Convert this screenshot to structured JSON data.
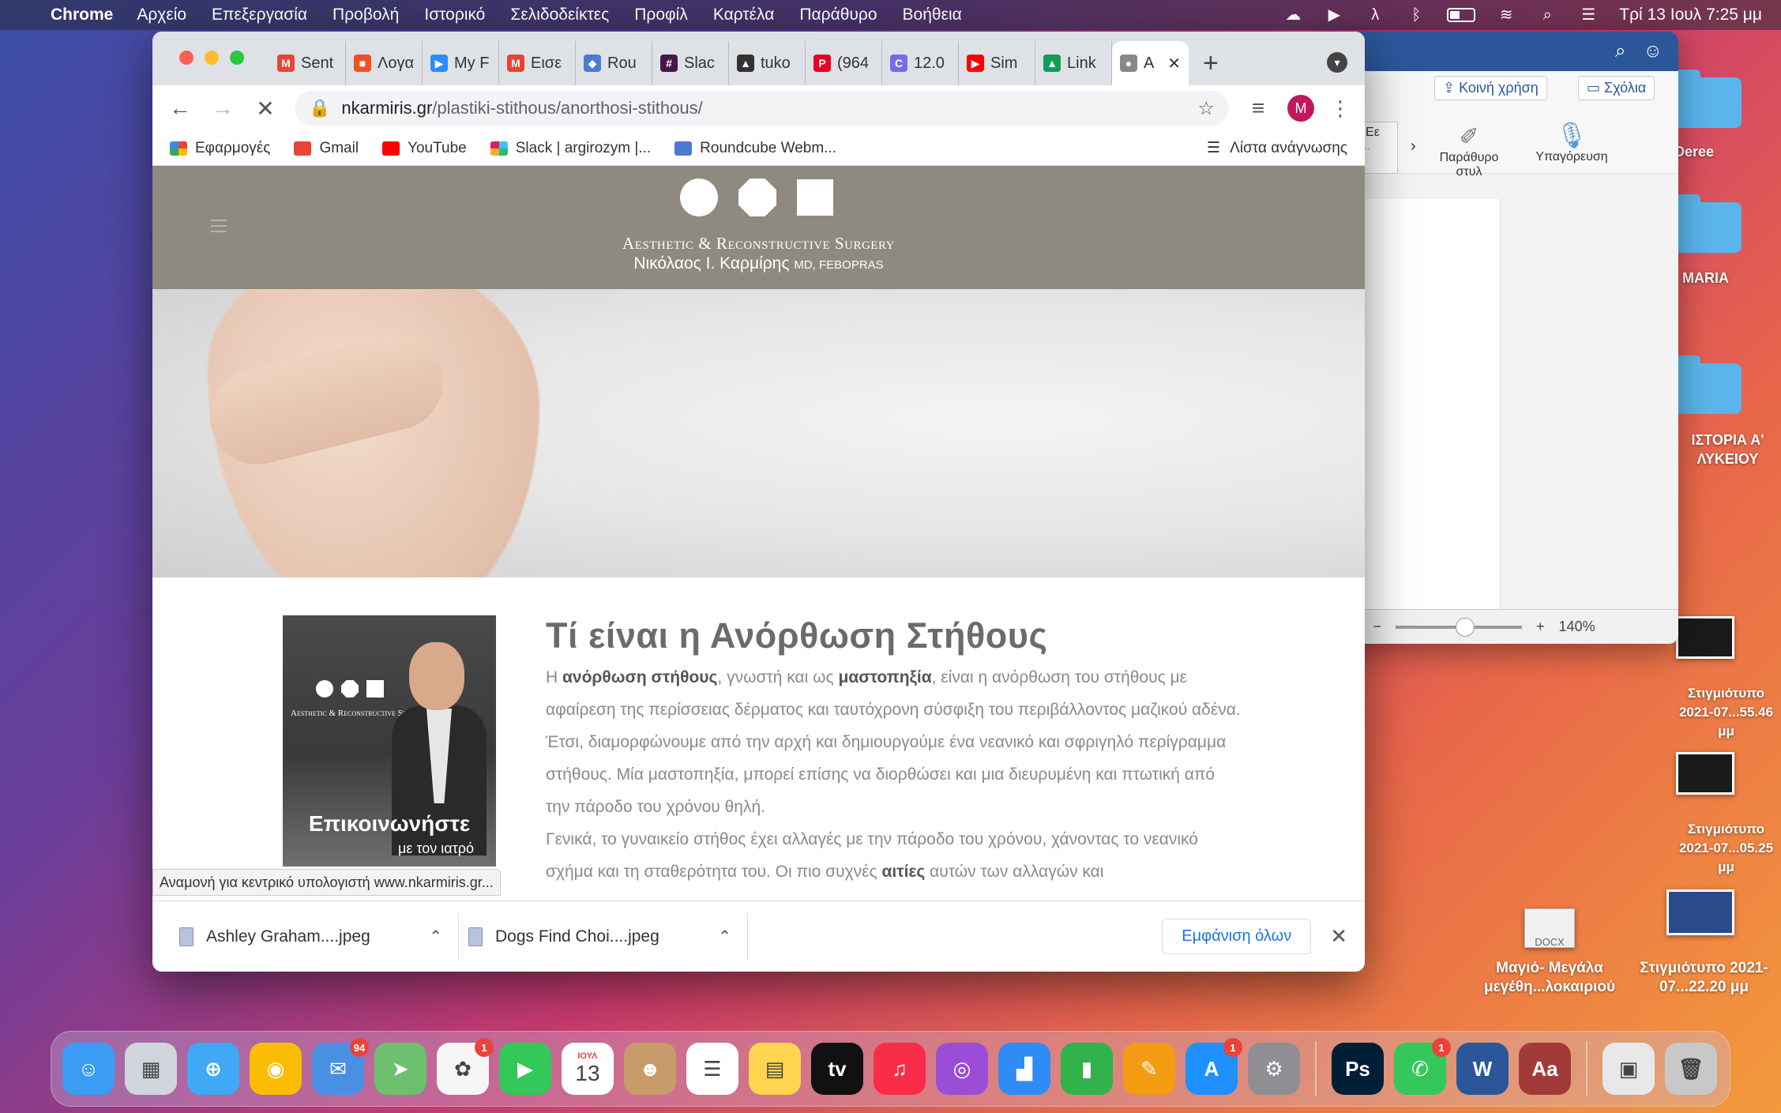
{
  "menubar": {
    "app_name": "Chrome",
    "items": [
      "Αρχείο",
      "Επεξεργασία",
      "Προβολή",
      "Ιστορικό",
      "Σελιδοδείκτες",
      "Προφίλ",
      "Καρτέλα",
      "Παράθυρο",
      "Βοήθεια"
    ],
    "clock": "Τρί 13 Ιουλ  7:25 μμ"
  },
  "desktop": {
    "folders": [
      {
        "label": "Deree"
      },
      {
        "label": "MARIA"
      },
      {
        "label": "ΙΣΤΟΡΙΑ Α' ΛΥΚΕΙΟΥ"
      }
    ],
    "screenshots": [
      {
        "label": "Στιγμιότυπο 2021-07...55.46 μμ"
      },
      {
        "label": "Στιγμιότυπο 2021-07...05.25 μμ"
      }
    ],
    "bottom_files": [
      {
        "label": "Μαγιό- Μεγάλα μεγέθη...λοκαιριού"
      },
      {
        "label": "Στιγμιότυπο 2021-07...22.20 μμ"
      }
    ],
    "docx_label": "DOCX"
  },
  "word": {
    "share_label": "Κοινή χρήση",
    "comments_label": "Σχόλια",
    "styles_label": "Παράθυρο στυλ",
    "dictate_label": "Υπαγόρευση",
    "partial_label": "ΑΔΒΕε",
    "partial_sub": "Ιάστι...",
    "zoom": "140%"
  },
  "chrome": {
    "tabs": [
      {
        "label": "Sent",
        "color": "#ea4335",
        "glyph": "M"
      },
      {
        "label": "Λογα",
        "color": "#f25022",
        "glyph": "■"
      },
      {
        "label": "My F",
        "color": "#2d8cff",
        "glyph": "▶"
      },
      {
        "label": "Εισε",
        "color": "#ea4335",
        "glyph": "M"
      },
      {
        "label": "Rou",
        "color": "#4a7bd0",
        "glyph": "◆"
      },
      {
        "label": "Slac",
        "color": "#4a154b",
        "glyph": "#"
      },
      {
        "label": "tuko",
        "color": "#333333",
        "glyph": "▲"
      },
      {
        "label": "(964",
        "color": "#e60023",
        "glyph": "P"
      },
      {
        "label": "12.0",
        "color": "#7b68ee",
        "glyph": "C"
      },
      {
        "label": "Sim",
        "color": "#ff0000",
        "glyph": "▶"
      },
      {
        "label": "Link",
        "color": "#0f9d58",
        "glyph": "▲"
      },
      {
        "label": "Α",
        "color": "#888888",
        "glyph": "●"
      }
    ],
    "url_domain": "nkarmiris.gr",
    "url_path": "/plastiki-stithous/anorthosi-stithous/",
    "profile_initial": "M",
    "bookmarks": [
      {
        "label": "Εφαρμογές",
        "color": "#4285f4"
      },
      {
        "label": "Gmail",
        "color": "#ea4335"
      },
      {
        "label": "YouTube",
        "color": "#ff0000"
      },
      {
        "label": "Slack | argirozym |...",
        "color": "#4a154b"
      },
      {
        "label": "Roundcube Webm...",
        "color": "#4a7bd0"
      }
    ],
    "reading_list": "Λίστα ανάγνωσης",
    "status_tip": "Αναμονή για κεντρικό υπολογιστή www.nkarmiris.gr...",
    "downloads": [
      {
        "name": "Ashley Graham....jpeg"
      },
      {
        "name": "Dogs Find Choi....jpeg"
      }
    ],
    "show_all": "Εμφάνιση όλων"
  },
  "site": {
    "brand_line1": "Aesthetic & Reconstructive Surgery",
    "brand_line2": "Νικόλαος Ι. Καρμίρης",
    "brand_suffix": "MD, FEBOPRAS",
    "card_brand": "Aesthetic & Reconstructive Surgery",
    "card_cta": "Επικοινωνήστε",
    "card_cta_sub": "με τον ιατρό",
    "title": "Τί είναι η Ανόρθωση Στήθους",
    "p1_a": "Η ",
    "p1_b1": "ανόρθωση στήθους",
    "p1_c": ", γνωστή και ως ",
    "p1_b2": "μαστοπηξία",
    "p1_d": ", είναι η ανόρθωση του στήθους με αφαίρεση της περίσσειας δέρματος και ταυτόχρονη σύσφιξη του περιβάλλοντος μαζικού αδένα. Έτσι, διαμορφώνουμε από την αρχή και δημιουργούμε ένα νεανικό και σφριγηλό περίγραμμα στήθους. Μία μαστοπηξία, μπορεί επίσης να διορθώσει και μια διευρυμένη και πτωτική από την πάροδο του χρόνου θηλή.",
    "p2_a": "Γενικά, το γυναικείο στήθος έχει αλλαγές με την πάροδο του χρόνου, χάνοντας το νεανικό σχήμα και τη σταθερότητα του. Οι πιο συχνές ",
    "p2_b": "αιτίες",
    "p2_c": " αυτών των αλλαγών και"
  },
  "dock": {
    "apps": [
      {
        "name": "finder",
        "color": "#3b9cf5",
        "glyph": "☺"
      },
      {
        "name": "launchpad",
        "color": "#d0d4dc",
        "glyph": "▦"
      },
      {
        "name": "safari",
        "color": "#3fa9f5",
        "glyph": "⊕"
      },
      {
        "name": "chrome",
        "color": "#fbbc05",
        "glyph": "◉"
      },
      {
        "name": "mail",
        "color": "#4a90e2",
        "glyph": "✉",
        "badge": "94"
      },
      {
        "name": "maps",
        "color": "#6cc070",
        "glyph": "➤"
      },
      {
        "name": "photos",
        "color": "#f5f5f5",
        "glyph": "✿",
        "badge": "1"
      },
      {
        "name": "facetime",
        "color": "#34c759",
        "glyph": "▶"
      },
      {
        "name": "calendar",
        "color": "#ffffff",
        "glyph": "13"
      },
      {
        "name": "contacts",
        "color": "#c89b6a",
        "glyph": "☻"
      },
      {
        "name": "reminders",
        "color": "#ffffff",
        "glyph": "☰"
      },
      {
        "name": "notes",
        "color": "#ffd54f",
        "glyph": "▤"
      },
      {
        "name": "apple-tv",
        "color": "#111111",
        "glyph": "tv"
      },
      {
        "name": "music",
        "color": "#fa2d48",
        "glyph": "♫"
      },
      {
        "name": "podcasts",
        "color": "#9b4dd8",
        "glyph": "◎"
      },
      {
        "name": "keynote",
        "color": "#2f8bf5",
        "glyph": "▟"
      },
      {
        "name": "numbers",
        "color": "#31b24b",
        "glyph": "▮"
      },
      {
        "name": "pages",
        "color": "#f39c12",
        "glyph": "✎"
      },
      {
        "name": "app-store",
        "color": "#1e90ff",
        "glyph": "A",
        "badge": "1"
      },
      {
        "name": "system-preferences",
        "color": "#8e8e93",
        "glyph": "⚙"
      },
      {
        "name": "photoshop",
        "color": "#001e36",
        "glyph": "Ps"
      },
      {
        "name": "messages",
        "color": "#34c759",
        "glyph": "✆",
        "badge": "1"
      },
      {
        "name": "word",
        "color": "#2b579a",
        "glyph": "W"
      },
      {
        "name": "dictionary",
        "color": "#a33a3a",
        "glyph": "Aa"
      },
      {
        "name": "preview",
        "color": "#e8e8e8",
        "glyph": "▣"
      },
      {
        "name": "trash",
        "color": "#c8c8c8",
        "glyph": "🗑"
      }
    ],
    "calendar_month": "ΙΟΥΛ"
  }
}
